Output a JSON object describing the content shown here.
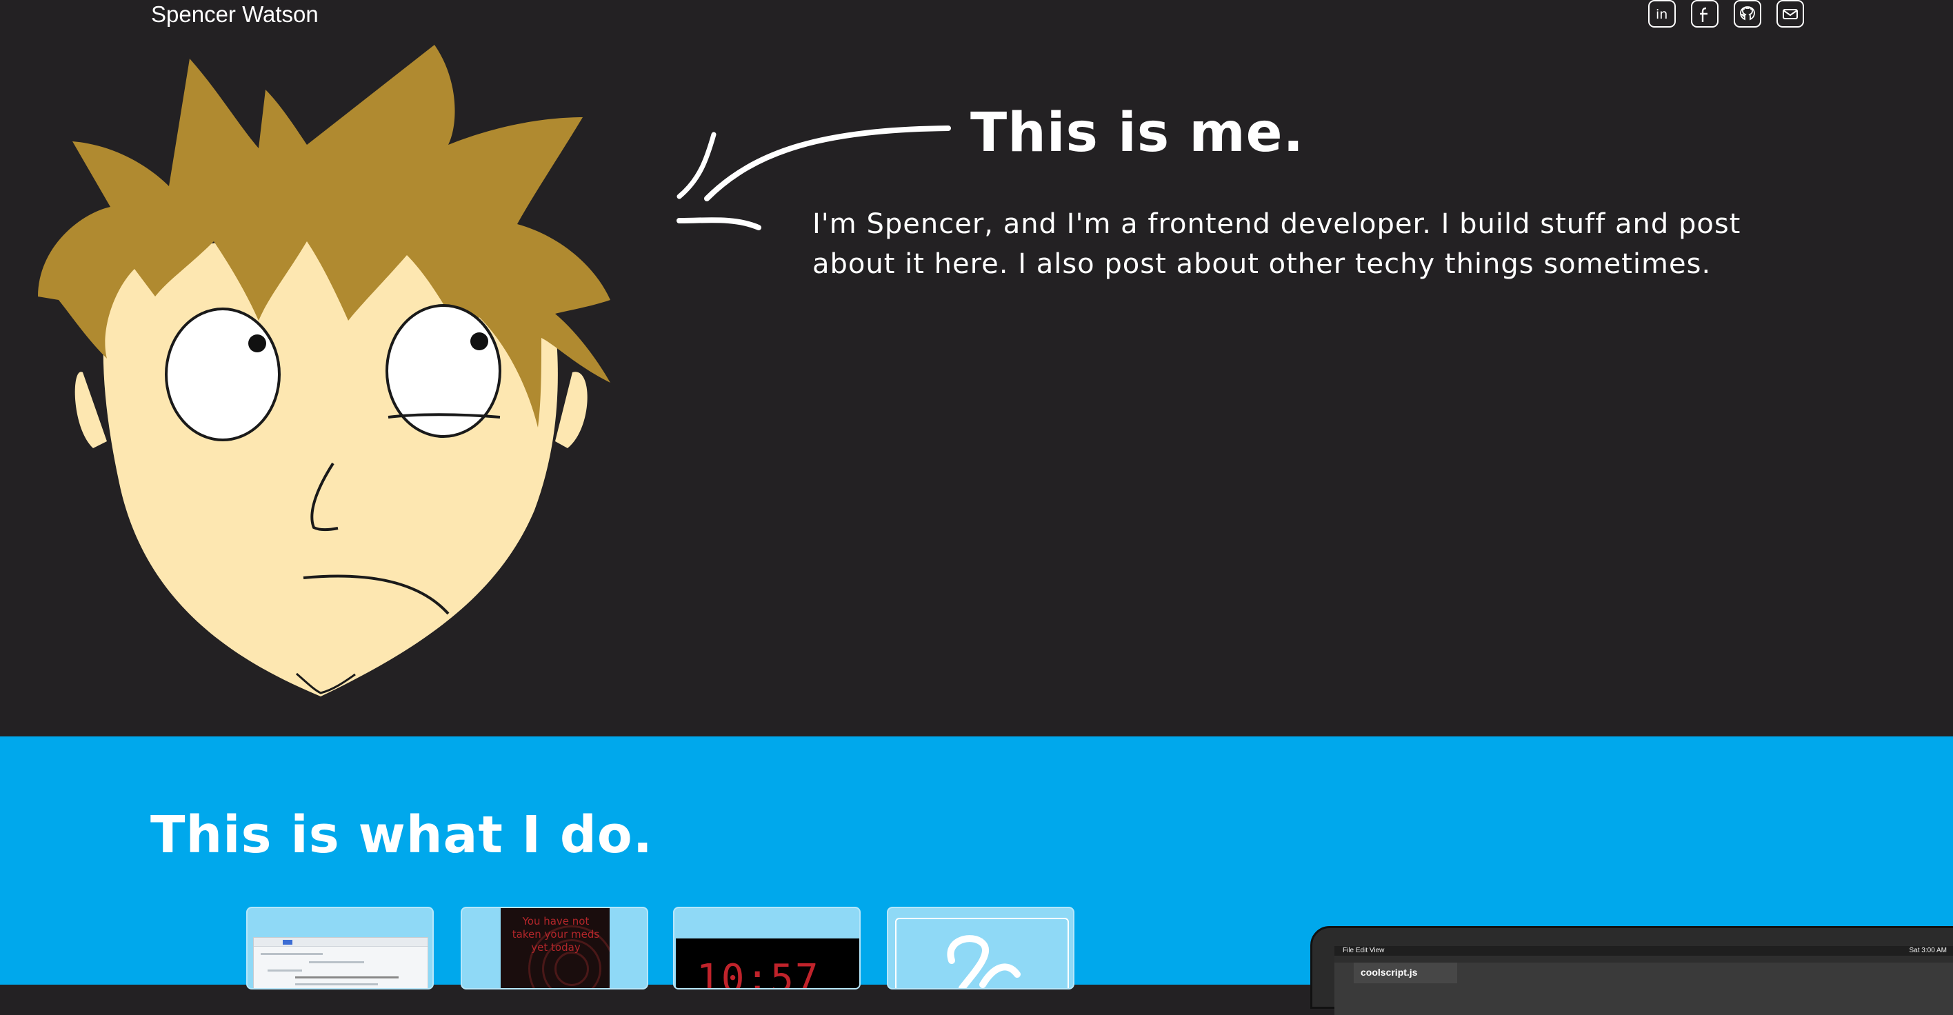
{
  "header": {
    "site_name": "Spencer Watson",
    "social": [
      {
        "icon": "linkedin-icon",
        "label": "in"
      },
      {
        "icon": "facebook-icon",
        "label": "f"
      },
      {
        "icon": "github-icon",
        "label": "github"
      },
      {
        "icon": "email-icon",
        "label": "email"
      }
    ]
  },
  "hero": {
    "title": "This is me.",
    "text": "I'm Spencer, and I'm a frontend developer. I build stuff and post about it here. I also post about other techy things sometimes."
  },
  "work": {
    "title": "This is what I do.",
    "cards": [
      {
        "name": "project-card-1"
      },
      {
        "name": "project-card-2",
        "screenshot_text": "You have not taken your meds yet today"
      },
      {
        "name": "project-card-3",
        "screenshot_text": "10:57"
      },
      {
        "name": "project-card-4"
      }
    ],
    "laptop": {
      "menubar_left": "File Edit View",
      "menubar_right": "Sat 3:00 AM",
      "file_tab": "coolscript.js"
    }
  },
  "colors": {
    "hero_bg": "#232123",
    "work_bg": "#00a8ec",
    "hair": "#b08a30",
    "skin": "#fde7b1"
  }
}
